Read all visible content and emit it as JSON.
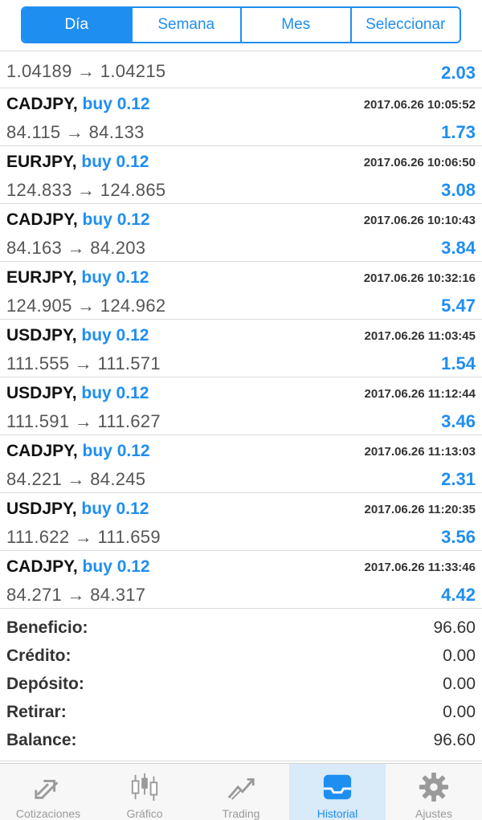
{
  "segments": [
    {
      "label": "Día",
      "active": true
    },
    {
      "label": "Semana",
      "active": false
    },
    {
      "label": "Mes",
      "active": false
    },
    {
      "label": "Seleccionar",
      "active": false
    }
  ],
  "partial_row": {
    "open": "1.04189",
    "close": "1.04215",
    "profit": "2.03"
  },
  "deals": [
    {
      "symbol": "CADJPY,",
      "side": "buy 0.12",
      "time": "2017.06.26 10:05:52",
      "open": "84.115",
      "close": "84.133",
      "profit": "1.73"
    },
    {
      "symbol": "EURJPY,",
      "side": "buy 0.12",
      "time": "2017.06.26 10:06:50",
      "open": "124.833",
      "close": "124.865",
      "profit": "3.08"
    },
    {
      "symbol": "CADJPY,",
      "side": "buy 0.12",
      "time": "2017.06.26 10:10:43",
      "open": "84.163",
      "close": "84.203",
      "profit": "3.84"
    },
    {
      "symbol": "EURJPY,",
      "side": "buy 0.12",
      "time": "2017.06.26 10:32:16",
      "open": "124.905",
      "close": "124.962",
      "profit": "5.47"
    },
    {
      "symbol": "USDJPY,",
      "side": "buy 0.12",
      "time": "2017.06.26 11:03:45",
      "open": "111.555",
      "close": "111.571",
      "profit": "1.54"
    },
    {
      "symbol": "USDJPY,",
      "side": "buy 0.12",
      "time": "2017.06.26 11:12:44",
      "open": "111.591",
      "close": "111.627",
      "profit": "3.46"
    },
    {
      "symbol": "CADJPY,",
      "side": "buy 0.12",
      "time": "2017.06.26 11:13:03",
      "open": "84.221",
      "close": "84.245",
      "profit": "2.31"
    },
    {
      "symbol": "USDJPY,",
      "side": "buy 0.12",
      "time": "2017.06.26 11:20:35",
      "open": "111.622",
      "close": "111.659",
      "profit": "3.56"
    },
    {
      "symbol": "CADJPY,",
      "side": "buy 0.12",
      "time": "2017.06.26 11:33:46",
      "open": "84.271",
      "close": "84.317",
      "profit": "4.42"
    }
  ],
  "arrow": "→",
  "summary": [
    {
      "label": "Beneficio:",
      "value": "96.60"
    },
    {
      "label": "Crédito:",
      "value": "0.00"
    },
    {
      "label": "Depósito:",
      "value": "0.00"
    },
    {
      "label": "Retirar:",
      "value": "0.00"
    },
    {
      "label": "Balance:",
      "value": "96.60"
    }
  ],
  "tabs": [
    {
      "label": "Cotizaciones",
      "icon": "quotes-arrows-icon",
      "active": false
    },
    {
      "label": "Gráfico",
      "icon": "candlestick-chart-icon",
      "active": false
    },
    {
      "label": "Trading",
      "icon": "trading-trend-icon",
      "active": false
    },
    {
      "label": "Historial",
      "icon": "history-inbox-icon",
      "active": true
    },
    {
      "label": "Ajustes",
      "icon": "gear-icon",
      "active": false
    }
  ],
  "colors": {
    "accent": "#1f8ef1",
    "divider": "#dcdcdc",
    "tab_active_bg": "#d9eaf9"
  }
}
